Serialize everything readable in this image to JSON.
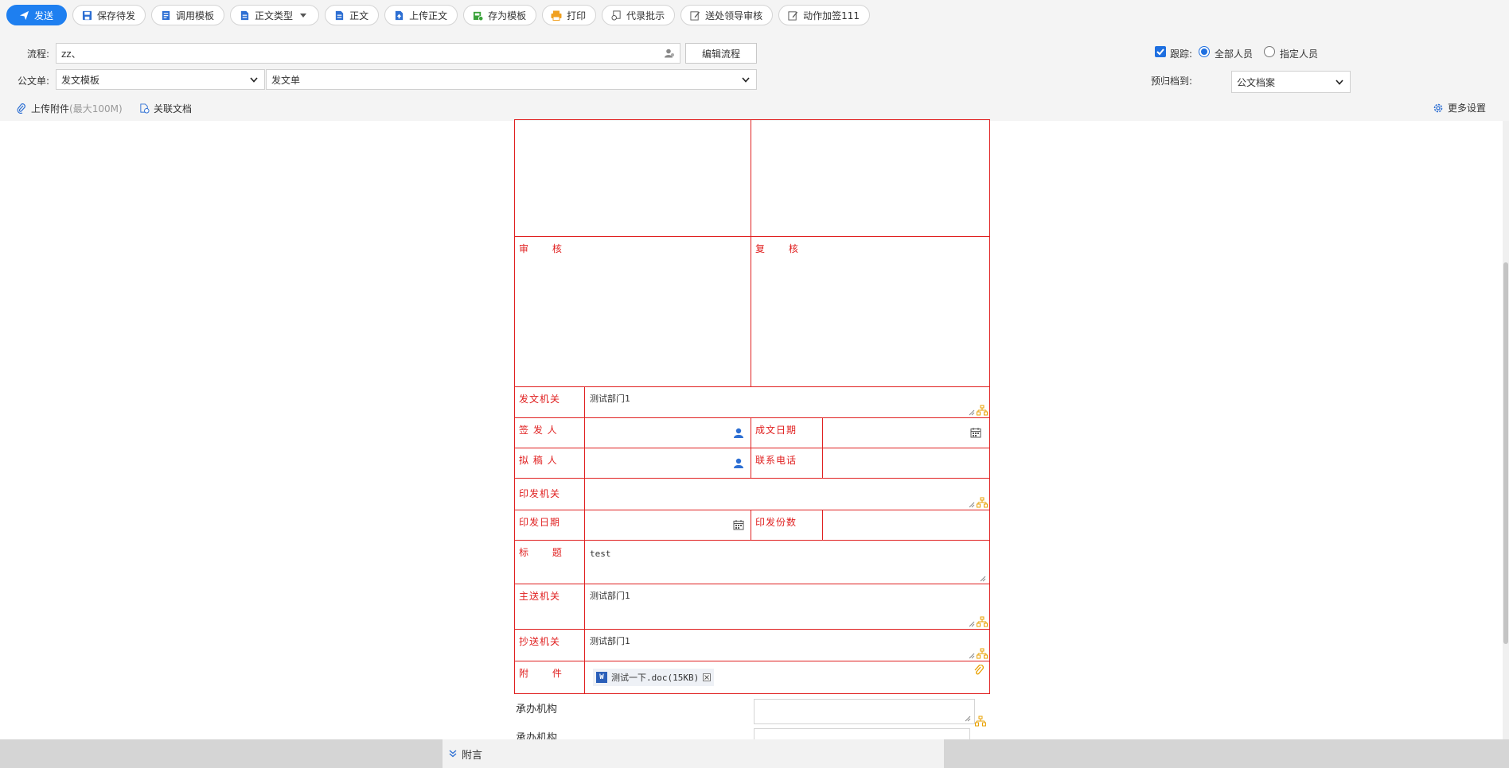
{
  "toolbar": {
    "send": "发送",
    "save_draft": "保存待发",
    "use_template": "调用模板",
    "body_type": "正文类型",
    "body": "正文",
    "upload_body": "上传正文",
    "save_template": "存为模板",
    "print": "打印",
    "proxy_approve": "代录批示",
    "send_leader": "送处领导审核",
    "action_sign": "动作加签111"
  },
  "header": {
    "flow_label": "流程:",
    "flow_value": "zz、",
    "edit_flow": "编辑流程",
    "doc_label": "公文单:",
    "doc_template": "发文模板",
    "doc_form": "发文单",
    "track_label": "跟踪:",
    "track_all": "全部人员",
    "track_specific": "指定人员",
    "archive_label": "预归档到:",
    "archive_value": "公文档案",
    "upload_attach": "上传附件",
    "upload_limit": "(最大100M)",
    "related_doc": "关联文档",
    "more_settings": "更多设置"
  },
  "form": {
    "shen_he": "审      核",
    "fu_he": "复      核",
    "issuing_org_label": "发文机关",
    "issuing_org_value": "测试部门1",
    "signer_label": "签 发 人",
    "date_label": "成文日期",
    "drafter_label": "拟 稿 人",
    "phone_label": "联系电话",
    "print_org_label": "印发机关",
    "print_date_label": "印发日期",
    "copies_label": "印发份数",
    "title_label": "标      题",
    "title_value": "test",
    "main_to_label": "主送机关",
    "main_to_value": "测试部门1",
    "cc_label": "抄送机关",
    "cc_value": "测试部门1",
    "attach_label": "附      件",
    "attach_file": "测试一下.doc(15KB)",
    "handler_1": "承办机构",
    "handler_2": "承办机构"
  },
  "notes_label": "附言",
  "colors": {
    "accent": "#1e7ff0",
    "form_red": "#e02020"
  }
}
